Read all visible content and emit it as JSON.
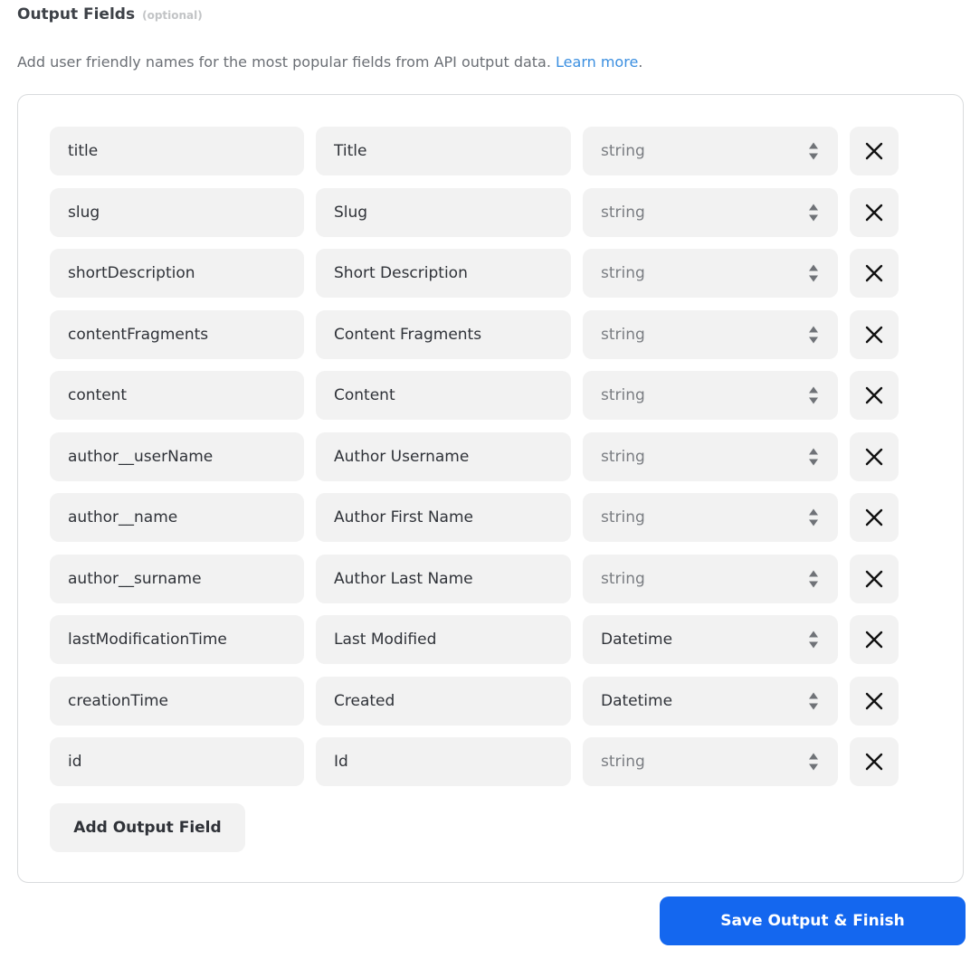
{
  "header": {
    "title": "Output Fields",
    "optional_label": "(optional)"
  },
  "description": {
    "text": "Add user friendly names for the most popular fields from API output data. ",
    "link_text": "Learn more",
    "period": "."
  },
  "fields": [
    {
      "key": "title",
      "label": "Title",
      "type": "string"
    },
    {
      "key": "slug",
      "label": "Slug",
      "type": "string"
    },
    {
      "key": "shortDescription",
      "label": "Short Description",
      "type": "string"
    },
    {
      "key": "contentFragments",
      "label": "Content Fragments",
      "type": "string"
    },
    {
      "key": "content",
      "label": "Content",
      "type": "string"
    },
    {
      "key": "author__userName",
      "label": "Author Username",
      "type": "string"
    },
    {
      "key": "author__name",
      "label": "Author First Name",
      "type": "string"
    },
    {
      "key": "author__surname",
      "label": "Author Last Name",
      "type": "string"
    },
    {
      "key": "lastModificationTime",
      "label": "Last Modified",
      "type": "Datetime"
    },
    {
      "key": "creationTime",
      "label": "Created",
      "type": "Datetime"
    },
    {
      "key": "id",
      "label": "Id",
      "type": "string"
    }
  ],
  "icons": {
    "type_select": "sort-arrows-icon",
    "remove": "close-icon"
  },
  "buttons": {
    "add_field": "Add Output Field",
    "save": "Save Output & Finish"
  },
  "colors": {
    "accent": "#1467ef",
    "link": "#3b8fe0",
    "field_background": "#f2f2f2"
  }
}
